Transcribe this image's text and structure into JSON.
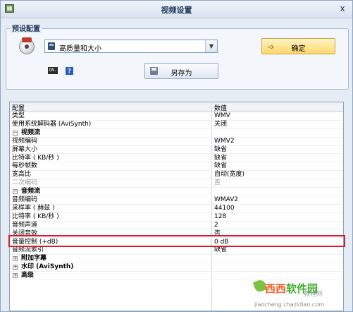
{
  "window": {
    "title": "视频设置",
    "close_label": "x"
  },
  "preset": {
    "group_label": "预设配置",
    "selected": "高质量和大小",
    "ok_label": "确定",
    "saveas_label": "另存为",
    "icon_a_text": "ON.",
    "icon_b_text": "?"
  },
  "grid": {
    "columns": [
      "配置",
      "数值"
    ],
    "rows": [
      {
        "key": "类型",
        "value": "WMV"
      },
      {
        "key": "使用系统解码器 (AviSynth)",
        "value": "关闭"
      },
      {
        "key": "视频流",
        "value": "",
        "group": true,
        "expander": "⊟"
      },
      {
        "key": "视频编码",
        "value": "WMV2"
      },
      {
        "key": "屏幕大小",
        "value": "缺省"
      },
      {
        "key": "比特率 ( KB/秒 )",
        "value": "缺省"
      },
      {
        "key": "每秒帧数",
        "value": "缺省"
      },
      {
        "key": "宽高比",
        "value": "自动(宽度)"
      },
      {
        "key": "二次编码",
        "value": "否",
        "disabled": true
      },
      {
        "key": "音频流",
        "value": "",
        "group": true,
        "expander": "⊟"
      },
      {
        "key": "音频编码",
        "value": "WMAV2"
      },
      {
        "key": "采样率 ( 赫兹 )",
        "value": "44100"
      },
      {
        "key": "比特率 ( KB/秒 )",
        "value": "128"
      },
      {
        "key": "音频声道",
        "value": "2"
      },
      {
        "key": "关闭音效",
        "value": "否"
      },
      {
        "key": "音量控制 (+dB)",
        "value": "0 dB"
      },
      {
        "key": "音频流索引",
        "value": "缺省"
      },
      {
        "key": "附加字幕",
        "value": "",
        "group": true,
        "expander": "⊞"
      },
      {
        "key": "水印 (AviSynth)",
        "value": "",
        "group": true,
        "expander": "⊞"
      },
      {
        "key": "高级",
        "value": "",
        "group": true,
        "expander": "⊞"
      }
    ]
  },
  "watermark": {
    "logo_part1": "西西",
    "logo_part2": "软件园",
    "overlay": "教程网",
    "url": "jiaocheng.chazidian.com"
  },
  "colors": {
    "highlight": "#d1202b",
    "accent": "#ffd86b"
  }
}
